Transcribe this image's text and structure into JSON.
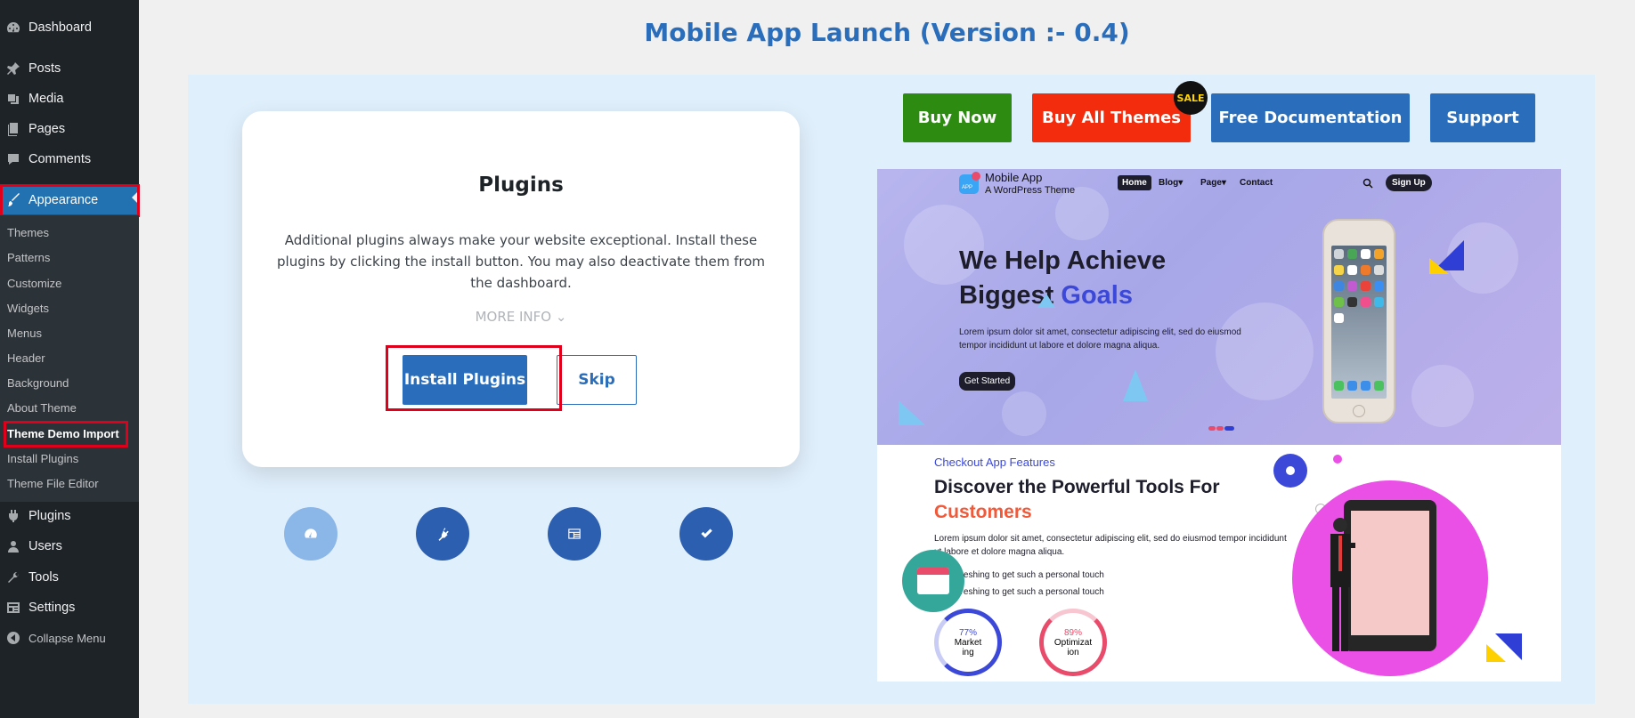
{
  "sidebar": {
    "items": [
      {
        "label": "Dashboard",
        "icon": "dashboard-icon"
      },
      {
        "label": "Posts",
        "icon": "pin-icon"
      },
      {
        "label": "Media",
        "icon": "media-icon"
      },
      {
        "label": "Pages",
        "icon": "pages-icon"
      },
      {
        "label": "Comments",
        "icon": "comment-icon"
      },
      {
        "label": "Appearance",
        "icon": "paintbrush-icon"
      }
    ],
    "submenu": [
      "Themes",
      "Patterns",
      "Customize",
      "Widgets",
      "Menus",
      "Header",
      "Background",
      "About Theme",
      "Theme Demo Import",
      "Install Plugins",
      "Theme File Editor"
    ],
    "lower_items": [
      {
        "label": "Plugins",
        "icon": "plugin-icon"
      },
      {
        "label": "Users",
        "icon": "user-icon"
      },
      {
        "label": "Tools",
        "icon": "wrench-icon"
      },
      {
        "label": "Settings",
        "icon": "settings-icon"
      }
    ],
    "collapse_label": "Collapse Menu"
  },
  "page": {
    "title": "Mobile App Launch (Version :- 0.4)"
  },
  "card": {
    "title": "Plugins",
    "description": "Additional plugins always make your website exceptional. Install these plugins by clicking the install button. You may also deactivate them from the dashboard.",
    "more_info": "MORE INFO ⌄",
    "install_label": "Install Plugins",
    "skip_label": "Skip"
  },
  "steps": [
    {
      "icon": "dashboard-step-icon",
      "color": "#8bb6e8"
    },
    {
      "icon": "plugin-step-icon",
      "color": "#2d5fb0"
    },
    {
      "icon": "layout-step-icon",
      "color": "#2d5fb0"
    },
    {
      "icon": "check-step-icon",
      "color": "#2d5fb0"
    }
  ],
  "top_buttons": {
    "buy_now": "Buy Now",
    "buy_all": "Buy All Themes",
    "sale": "SALE",
    "docs": "Free Documentation",
    "support": "Support"
  },
  "colors": {
    "wp_blue": "#2271b1",
    "accent_blue": "#2a6ebb",
    "buy_now_green": "#2e8b12",
    "buy_all_red": "#f22c0c",
    "highlight_red": "#e0001b"
  },
  "preview": {
    "brand": "Mobile App",
    "brand_sub": "A WordPress Theme",
    "logo_text": "APP",
    "nav": [
      "Home",
      "Blog",
      "Page",
      "Contact"
    ],
    "signup": "Sign Up",
    "hero_title_1": "We Help Achieve",
    "hero_title_2": "Biggest",
    "hero_title_accent": "Goals",
    "hero_text": "Lorem ipsum dolor sit amet, consectetur adipiscing elit, sed do eiusmod tempor incididunt ut labore et dolore magna aliqua.",
    "hero_button": "Get Started",
    "features_kicker": "Checkout App Features",
    "features_title_1": "Discover the Powerful Tools For",
    "features_title_accent": "Customers",
    "features_text": "Lorem ipsum dolor sit amet, consectetur adipiscing elit, sed do eiusmod tempor incididunt ut labore et dolore magna aliqua.",
    "bullets": [
      "Refreshing to get such a personal touch",
      "Refreshing to get such a personal touch"
    ],
    "rings": [
      {
        "pct": "77%",
        "label": "Market ing",
        "color": "#3b48d8"
      },
      {
        "pct": "89%",
        "label": "Optimizat ion",
        "color": "#e94b6b"
      }
    ]
  }
}
